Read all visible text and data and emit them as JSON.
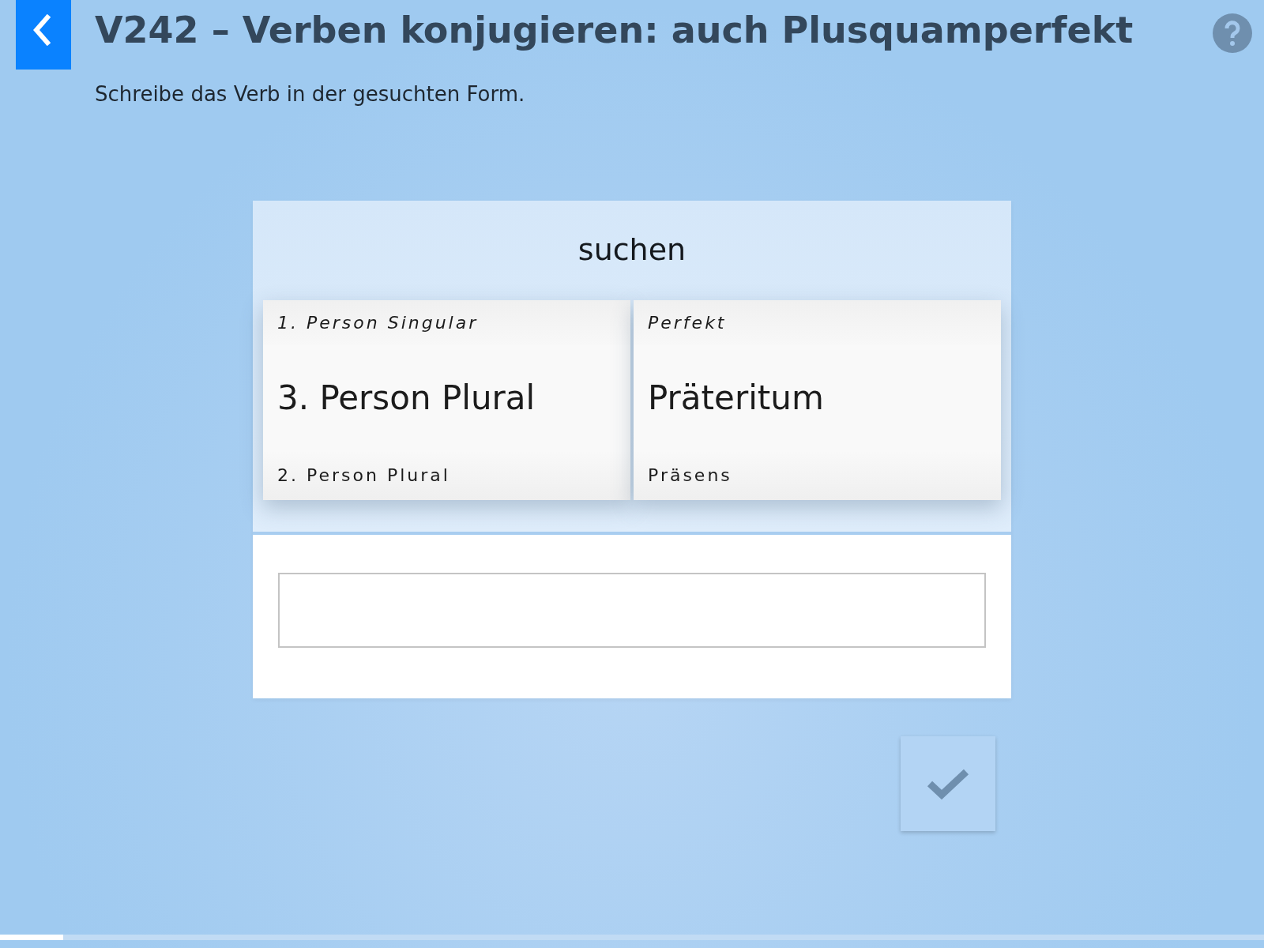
{
  "header": {
    "title": "V242 – Verben konjugieren: auch Plusquamperfekt",
    "instruction": "Schreibe das Verb in der gesuchten Form."
  },
  "exercise": {
    "verb": "suchen",
    "wheels": [
      {
        "items": [
          {
            "label": "1. Person Singular",
            "selected": false
          },
          {
            "label": "3. Person Plural",
            "selected": true
          },
          {
            "label": "2. Person Plural",
            "selected": false
          }
        ]
      },
      {
        "items": [
          {
            "label": "Perfekt",
            "selected": false
          },
          {
            "label": "Präteritum",
            "selected": true
          },
          {
            "label": "Präsens",
            "selected": false
          }
        ]
      }
    ]
  },
  "progress": {
    "level": 0.05
  }
}
